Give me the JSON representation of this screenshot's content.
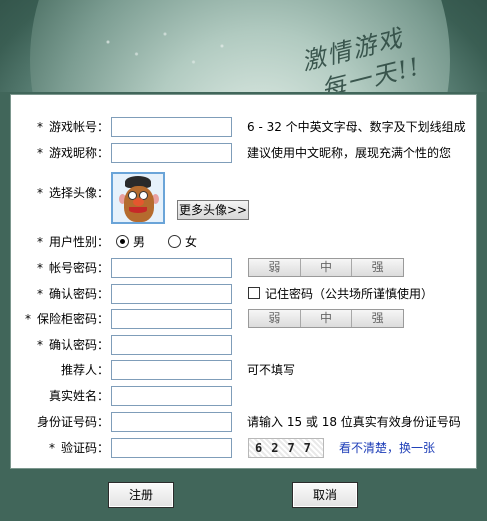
{
  "header": {
    "slogan_line1": "激情游戏",
    "slogan_line2": "每一天",
    "exclaim": "!!"
  },
  "form": {
    "account": {
      "label": "游戏帐号：",
      "value": "",
      "hint": "6 - 32 个中英文字母、数字及下划线组成"
    },
    "nickname": {
      "label": "游戏昵称：",
      "value": "",
      "hint": "建议使用中文昵称，展现充满个性的您"
    },
    "avatar": {
      "label": "选择头像：",
      "more_button": "更多头像>>"
    },
    "gender": {
      "label": "用户性别：",
      "male": "男",
      "female": "女",
      "selected": "male"
    },
    "password": {
      "label": "帐号密码：",
      "value": ""
    },
    "strength": [
      "弱",
      "中",
      "强"
    ],
    "confirm_password": {
      "label": "确认密码：",
      "value": "",
      "remember_label": "记住密码（公共场所谨慎使用）"
    },
    "safe_password": {
      "label": "保险柜密码：",
      "value": ""
    },
    "confirm_safe_password": {
      "label": "确认密码：",
      "value": ""
    },
    "referrer": {
      "label": "推荐人：",
      "value": "",
      "hint": "可不填写"
    },
    "realname": {
      "label": "真实姓名：",
      "value": ""
    },
    "idcard": {
      "label": "身份证号码：",
      "value": "",
      "hint": "请输入 15 或 18 位真实有效身份证号码"
    },
    "captcha": {
      "label": "验证码：",
      "value": "",
      "code": "6277",
      "refresh_link": "看不清楚，换一张"
    }
  },
  "required_mark": "*",
  "buttons": {
    "register": "注册",
    "cancel": "取消"
  },
  "colors": {
    "background": "#41665a",
    "link": "#1f3fb8",
    "input_border": "#7f9db9"
  }
}
